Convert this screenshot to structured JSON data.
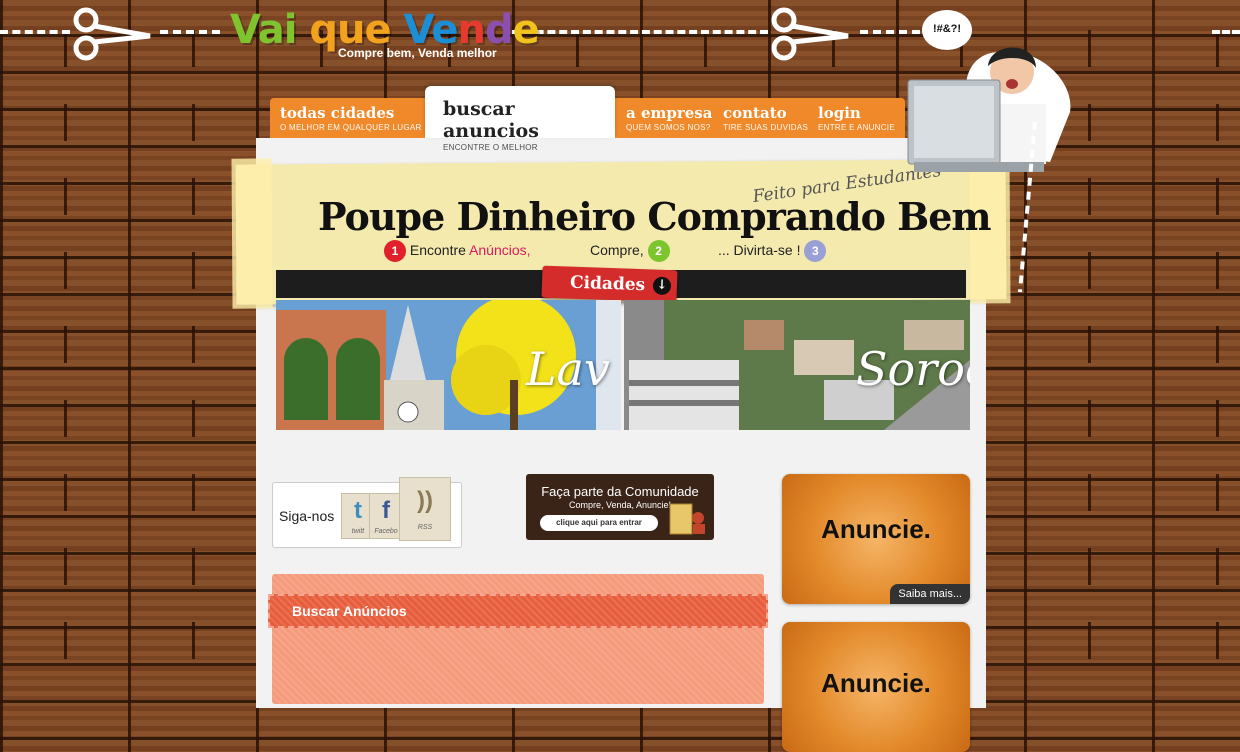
{
  "brand": {
    "logo_letters": [
      "Vai ",
      "que ",
      "Ve",
      "n",
      "d",
      "e"
    ],
    "logo_colors": [
      "#7fc32f",
      "#f2a21c",
      "#1c8ed6",
      "#e53a2d",
      "#8b4fb0",
      "#f2c21c"
    ],
    "tagline": "Compre bem, Venda melhor"
  },
  "nav": {
    "tabs": [
      {
        "label": "todas cidades",
        "sub": "o melhor em qualquer lugar",
        "active": false
      },
      {
        "label": "buscar anuncios",
        "sub": "encontre o melhor",
        "active": true
      },
      {
        "label": "a empresa",
        "sub": "quem somos nos?",
        "active": false
      },
      {
        "label": "contato",
        "sub": "tire suas duvidas",
        "active": false
      },
      {
        "label": "login",
        "sub": "entre e anuncie",
        "active": false
      }
    ]
  },
  "banner": {
    "kicker": "Feito para Estudantes",
    "headline": "Poupe Dinheiro Comprando Bem",
    "steps": [
      {
        "num": "1",
        "pre": "Encontre ",
        "highlight": "Anúncios,",
        "color": "#e0202a"
      },
      {
        "num": "2",
        "pre": "Compre,",
        "highlight": "",
        "color": "#7cc52c"
      },
      {
        "num": "3",
        "pre": "... Divirta-se !",
        "highlight": "",
        "color": "#9aa0d6"
      }
    ],
    "cidades_button": "Cidades"
  },
  "photos": {
    "city_1": "Lav",
    "city_2": "Soroc"
  },
  "bubble": "!#&?!",
  "social": {
    "label": "Siga-nos",
    "items": [
      {
        "glyph": "t",
        "caption": "twitt",
        "color": "#3b8ec2"
      },
      {
        "glyph": "f",
        "caption": "Facebo",
        "color": "#3b5998"
      },
      {
        "glyph": "))",
        "caption": "RSS",
        "color": "#8a7a55"
      }
    ]
  },
  "community": {
    "title": "Faça parte da Comunidade",
    "subtitle": "Compre, Venda, Anuncie!",
    "button": "clique aqui para entrar"
  },
  "ads": [
    {
      "text": "Anuncie.",
      "more": "Saiba mais..."
    },
    {
      "text": "Anuncie.",
      "more": ""
    }
  ],
  "search": {
    "title": "Buscar Anúncios"
  }
}
